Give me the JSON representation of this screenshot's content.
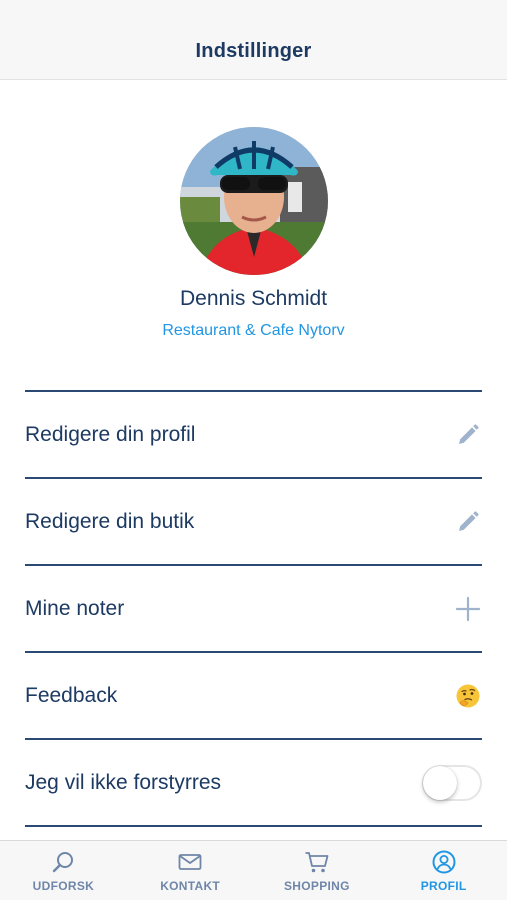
{
  "navbar": {
    "title": "Indstillinger"
  },
  "profile": {
    "name": "Dennis Schmidt",
    "shop": "Restaurant & Cafe Nytorv"
  },
  "settings": {
    "items": [
      {
        "label": "Redigere din profil",
        "icon": "pencil-icon"
      },
      {
        "label": "Redigere din butik",
        "icon": "pencil-icon"
      },
      {
        "label": "Mine noter",
        "icon": "plus-icon"
      },
      {
        "label": "Feedback",
        "icon": "thinking-face-emoji-icon"
      },
      {
        "label": "Jeg vil ikke forstyrres",
        "icon": "toggle-switch",
        "toggle_on": false
      }
    ]
  },
  "tabbar": {
    "tabs": [
      {
        "label": "UDFORSK",
        "icon": "search-icon",
        "active": false
      },
      {
        "label": "KONTAKT",
        "icon": "envelope-icon",
        "active": false
      },
      {
        "label": "SHOPPING",
        "icon": "cart-icon",
        "active": false
      },
      {
        "label": "PROFIL",
        "icon": "user-circle-icon",
        "active": true
      }
    ]
  },
  "colors": {
    "text_primary": "#1d3a63",
    "accent": "#2196e3",
    "divider": "#2a4a74",
    "icon_muted": "#9fb4cc",
    "tab_inactive": "#6f86a8"
  }
}
